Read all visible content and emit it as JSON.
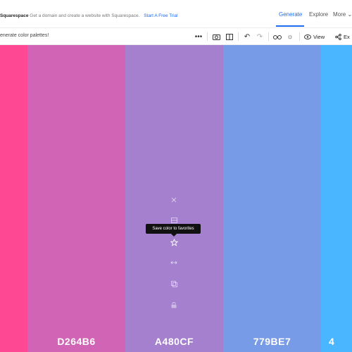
{
  "header": {
    "promo_brand": "Squarespace",
    "promo_text": "Get a domain and create a website with Squarespace.",
    "promo_cta": "Start A Free Trial",
    "nav": [
      "Generate",
      "Explore",
      "More"
    ],
    "accent_color": "#1d6bf3"
  },
  "toolbar": {
    "hint": "enerate color palettes!",
    "view_label": "View",
    "export_label": "Ex",
    "icons": [
      "more-icon",
      "camera-icon",
      "panel-icon",
      "undo-icon",
      "redo-icon",
      "glasses-icon",
      "sun-icon",
      "eye-icon",
      "share-icon"
    ]
  },
  "palette": {
    "swatches": [
      {
        "hex": "",
        "color": "#FF4893"
      },
      {
        "hex": "D264B6",
        "color": "#D264B6"
      },
      {
        "hex": "A480CF",
        "color": "#A480CF"
      },
      {
        "hex": "779BE7",
        "color": "#779BE7"
      },
      {
        "hex": "4",
        "color": "#49B6FF"
      }
    ],
    "active_tools": [
      "close-icon",
      "grid-icon",
      "star-icon",
      "drag-icon",
      "copy-icon",
      "lock-icon"
    ],
    "tooltip": "Save color to favorites"
  }
}
